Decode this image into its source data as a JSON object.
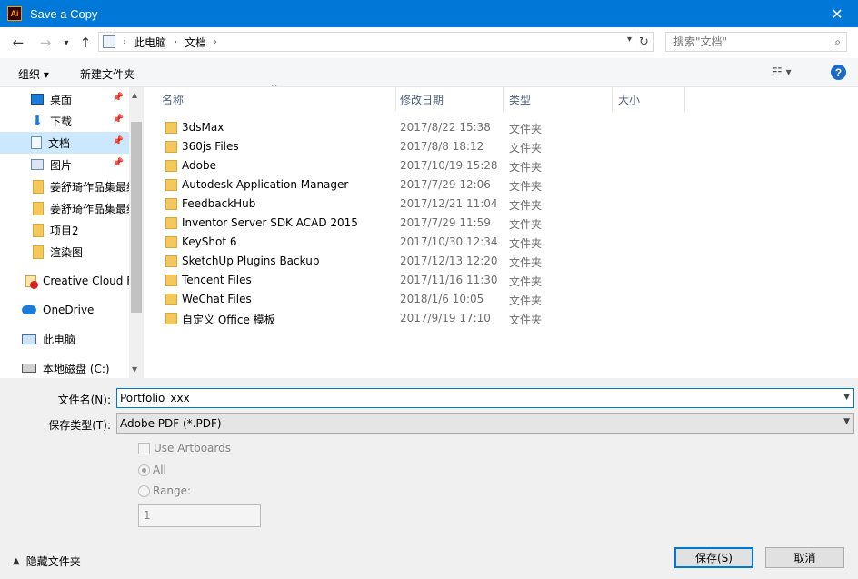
{
  "window": {
    "title": "Save a Copy",
    "app_icon_text": "Ai",
    "close_glyph": "✕"
  },
  "nav": {
    "back_glyph": "←",
    "forward_glyph": "→",
    "up_glyph": "↑",
    "breadcrumbs": [
      "此电脑",
      "文档"
    ],
    "crumb_sep": "›",
    "refresh_glyph": "↻",
    "search_placeholder": "搜索\"文档\""
  },
  "toolbar": {
    "organize": "组织 ▾",
    "new_folder": "新建文件夹",
    "view_glyph": "☷ ▾",
    "help": "?"
  },
  "sidebar": {
    "items": [
      {
        "label": "桌面",
        "icon": "desktop-icon",
        "pinned": true
      },
      {
        "label": "下载",
        "icon": "download-icon",
        "pinned": true
      },
      {
        "label": "文档",
        "icon": "document-icon",
        "pinned": true,
        "selected": true
      },
      {
        "label": "图片",
        "icon": "pictures-icon",
        "pinned": true
      },
      {
        "label": "姜舒琦作品集最终",
        "icon": "folder-icon"
      },
      {
        "label": "姜舒琦作品集最终",
        "icon": "folder-icon"
      },
      {
        "label": "项目2",
        "icon": "folder-icon"
      },
      {
        "label": "渲染图",
        "icon": "folder-icon"
      },
      {
        "label": "Creative Cloud Files",
        "icon": "creative-cloud-icon"
      },
      {
        "label": "OneDrive",
        "icon": "onedrive-icon"
      },
      {
        "label": "此电脑",
        "icon": "this-pc-icon"
      },
      {
        "label": "本地磁盘 (C:)",
        "icon": "drive-icon"
      }
    ],
    "pin_glyph": "📌"
  },
  "filelist": {
    "columns": [
      "名称",
      "修改日期",
      "类型",
      "大小"
    ],
    "rows": [
      {
        "name": "3dsMax",
        "date": "2017/8/22 15:38",
        "type": "文件夹"
      },
      {
        "name": "360js Files",
        "date": "2017/8/8 18:12",
        "type": "文件夹"
      },
      {
        "name": "Adobe",
        "date": "2017/10/19 15:28",
        "type": "文件夹"
      },
      {
        "name": "Autodesk Application Manager",
        "date": "2017/7/29 12:06",
        "type": "文件夹"
      },
      {
        "name": "FeedbackHub",
        "date": "2017/12/21 11:04",
        "type": "文件夹"
      },
      {
        "name": "Inventor Server SDK ACAD 2015",
        "date": "2017/7/29 11:59",
        "type": "文件夹"
      },
      {
        "name": "KeyShot 6",
        "date": "2017/10/30 12:34",
        "type": "文件夹"
      },
      {
        "name": "SketchUp Plugins Backup",
        "date": "2017/12/13 12:20",
        "type": "文件夹"
      },
      {
        "name": "Tencent Files",
        "date": "2017/11/16 11:30",
        "type": "文件夹"
      },
      {
        "name": "WeChat Files",
        "date": "2018/1/6 10:05",
        "type": "文件夹"
      },
      {
        "name": "自定义 Office 模板",
        "date": "2017/9/19 17:10",
        "type": "文件夹"
      }
    ]
  },
  "form": {
    "filename_label": "文件名(N):",
    "filename_value": "Portfolio_xxx",
    "filetype_label": "保存类型(T):",
    "filetype_value": "Adobe PDF (*.PDF)",
    "use_artboards": "Use Artboards",
    "all": "All",
    "range": "Range:",
    "range_value": "1"
  },
  "footer": {
    "hide_folders": "隐藏文件夹",
    "save": "保存(S)",
    "cancel": "取消"
  }
}
